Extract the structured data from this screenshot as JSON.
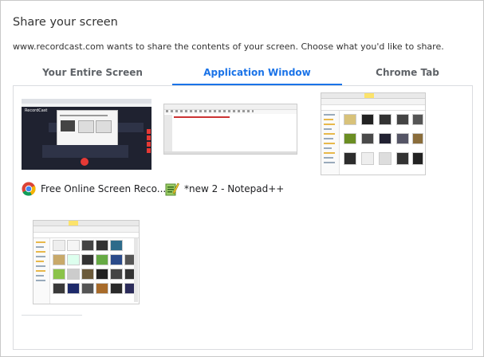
{
  "dialog": {
    "title": "Share your screen",
    "subtitle": "www.recordcast.com wants to share the contents of your screen. Choose what you'd like to share."
  },
  "tabs": [
    {
      "label": "Your Entire Screen",
      "active": false
    },
    {
      "label": "Application Window",
      "active": true
    },
    {
      "label": "Chrome Tab",
      "active": false
    }
  ],
  "windows": [
    {
      "label": "Free Online Screen Reco...",
      "icon": "chrome-icon",
      "thumb_text": "RecordCast"
    },
    {
      "label": "*new 2 - Notepad++",
      "icon": "notepad-plus-plus-icon"
    },
    {
      "label": "",
      "icon": "file-explorer-icon"
    },
    {
      "label": "",
      "icon": "file-explorer-icon"
    }
  ],
  "colors": {
    "accent": "#1a73e8",
    "tab_inactive": "#5f6368",
    "record_button": "#e53935",
    "dark_app_bg": "#1f2230"
  }
}
